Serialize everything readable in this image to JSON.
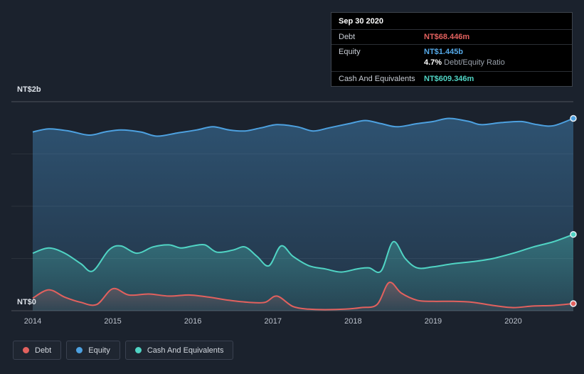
{
  "page": {
    "background": "#1b222d"
  },
  "tooltip": {
    "date": "Sep 30 2020",
    "debt_label": "Debt",
    "debt_value": "NT$68.446m",
    "equity_label": "Equity",
    "equity_value": "NT$1.445b",
    "ratio_value": "4.7%",
    "ratio_label": "Debt/Equity Ratio",
    "cash_label": "Cash And Equivalents",
    "cash_value": "NT$609.346m"
  },
  "legend": [
    {
      "label": "Debt",
      "color": "#e2615e"
    },
    {
      "label": "Equity",
      "color": "#4da1e0"
    },
    {
      "label": "Cash And Equivalents",
      "color": "#50d4c4"
    }
  ],
  "chart_data": {
    "type": "area",
    "title": "Debt, Equity and Cash And Equivalents over time",
    "x_range": [
      2014,
      2020.75
    ],
    "ylim": [
      0,
      2
    ],
    "y_unit": "NT$ billions",
    "grid": true,
    "legend_position": "bottom-left",
    "y_ticks": [
      {
        "value": 2,
        "label": "NT$2b"
      },
      {
        "value": 0,
        "label": "NT$0"
      }
    ],
    "gridline_values": [
      2,
      1.5,
      1,
      0.5,
      0
    ],
    "x_ticks": [
      {
        "value": 2014,
        "label": "2014"
      },
      {
        "value": 2015,
        "label": "2015"
      },
      {
        "value": 2016,
        "label": "2016"
      },
      {
        "value": 2017,
        "label": "2017"
      },
      {
        "value": 2018,
        "label": "2018"
      },
      {
        "value": 2019,
        "label": "2019"
      },
      {
        "value": 2020,
        "label": "2020"
      }
    ],
    "series": [
      {
        "name": "Equity",
        "color": "#4da1e0",
        "fill_top": 0.38,
        "fill_bottom": 0.14,
        "points": [
          [
            2014.0,
            1.71
          ],
          [
            2014.2,
            1.74
          ],
          [
            2014.45,
            1.72
          ],
          [
            2014.7,
            1.68
          ],
          [
            2014.9,
            1.71
          ],
          [
            2015.1,
            1.73
          ],
          [
            2015.35,
            1.71
          ],
          [
            2015.55,
            1.67
          ],
          [
            2015.8,
            1.7
          ],
          [
            2016.05,
            1.73
          ],
          [
            2016.25,
            1.76
          ],
          [
            2016.45,
            1.73
          ],
          [
            2016.65,
            1.72
          ],
          [
            2016.85,
            1.75
          ],
          [
            2017.05,
            1.78
          ],
          [
            2017.3,
            1.76
          ],
          [
            2017.5,
            1.72
          ],
          [
            2017.7,
            1.75
          ],
          [
            2017.95,
            1.79
          ],
          [
            2018.15,
            1.82
          ],
          [
            2018.35,
            1.79
          ],
          [
            2018.55,
            1.76
          ],
          [
            2018.8,
            1.79
          ],
          [
            2019.0,
            1.81
          ],
          [
            2019.2,
            1.84
          ],
          [
            2019.45,
            1.81
          ],
          [
            2019.6,
            1.78
          ],
          [
            2019.85,
            1.8
          ],
          [
            2020.1,
            1.81
          ],
          [
            2020.3,
            1.78
          ],
          [
            2020.5,
            1.77
          ],
          [
            2020.75,
            1.84
          ]
        ]
      },
      {
        "name": "Cash And Equivalents",
        "color": "#50d4c4",
        "fill_top": 0.32,
        "fill_bottom": 0.1,
        "points": [
          [
            2014.0,
            0.55
          ],
          [
            2014.2,
            0.6
          ],
          [
            2014.4,
            0.55
          ],
          [
            2014.6,
            0.45
          ],
          [
            2014.75,
            0.38
          ],
          [
            2014.95,
            0.58
          ],
          [
            2015.1,
            0.62
          ],
          [
            2015.3,
            0.55
          ],
          [
            2015.5,
            0.61
          ],
          [
            2015.7,
            0.63
          ],
          [
            2015.85,
            0.6
          ],
          [
            2016.0,
            0.62
          ],
          [
            2016.15,
            0.63
          ],
          [
            2016.3,
            0.56
          ],
          [
            2016.5,
            0.58
          ],
          [
            2016.65,
            0.61
          ],
          [
            2016.8,
            0.52
          ],
          [
            2016.95,
            0.43
          ],
          [
            2017.1,
            0.62
          ],
          [
            2017.25,
            0.52
          ],
          [
            2017.45,
            0.43
          ],
          [
            2017.65,
            0.4
          ],
          [
            2017.85,
            0.37
          ],
          [
            2018.05,
            0.4
          ],
          [
            2018.2,
            0.41
          ],
          [
            2018.35,
            0.38
          ],
          [
            2018.5,
            0.66
          ],
          [
            2018.65,
            0.5
          ],
          [
            2018.8,
            0.41
          ],
          [
            2019.0,
            0.42
          ],
          [
            2019.25,
            0.45
          ],
          [
            2019.5,
            0.47
          ],
          [
            2019.75,
            0.5
          ],
          [
            2020.0,
            0.55
          ],
          [
            2020.25,
            0.61
          ],
          [
            2020.5,
            0.66
          ],
          [
            2020.75,
            0.73
          ]
        ]
      },
      {
        "name": "Debt",
        "color": "#e2615e",
        "fill_top": 0.3,
        "fill_bottom": 0.05,
        "points": [
          [
            2014.0,
            0.12
          ],
          [
            2014.2,
            0.2
          ],
          [
            2014.4,
            0.13
          ],
          [
            2014.6,
            0.08
          ],
          [
            2014.8,
            0.06
          ],
          [
            2015.0,
            0.21
          ],
          [
            2015.2,
            0.15
          ],
          [
            2015.45,
            0.16
          ],
          [
            2015.7,
            0.14
          ],
          [
            2015.95,
            0.15
          ],
          [
            2016.2,
            0.13
          ],
          [
            2016.45,
            0.1
          ],
          [
            2016.7,
            0.08
          ],
          [
            2016.9,
            0.08
          ],
          [
            2017.05,
            0.14
          ],
          [
            2017.25,
            0.04
          ],
          [
            2017.45,
            0.015
          ],
          [
            2017.65,
            0.01
          ],
          [
            2017.9,
            0.015
          ],
          [
            2018.1,
            0.03
          ],
          [
            2018.3,
            0.06
          ],
          [
            2018.45,
            0.27
          ],
          [
            2018.6,
            0.17
          ],
          [
            2018.8,
            0.1
          ],
          [
            2019.0,
            0.09
          ],
          [
            2019.25,
            0.09
          ],
          [
            2019.5,
            0.08
          ],
          [
            2019.75,
            0.05
          ],
          [
            2020.0,
            0.03
          ],
          [
            2020.25,
            0.045
          ],
          [
            2020.5,
            0.05
          ],
          [
            2020.75,
            0.068
          ]
        ]
      }
    ]
  }
}
